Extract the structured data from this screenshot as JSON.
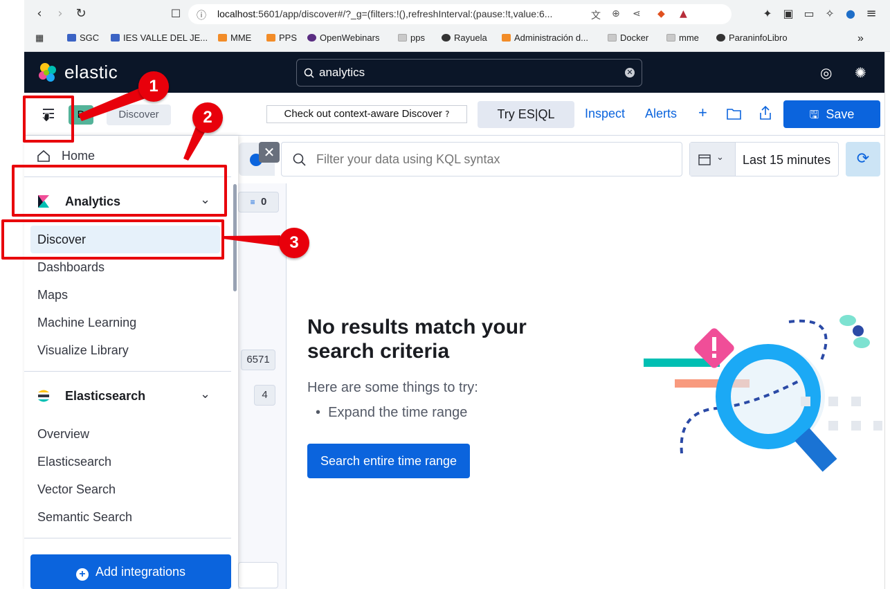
{
  "browser": {
    "url_host": "localhost",
    "url_rest": ":5601/app/discover#/?_g=(filters:!(),refreshInterval:(pause:!t,value:6...",
    "bookmarks": [
      {
        "label": "SGC",
        "icon": "ies-icon"
      },
      {
        "label": "IES VALLE DEL JE...",
        "icon": "ies-icon"
      },
      {
        "label": "MME",
        "icon": "moodle-icon"
      },
      {
        "label": "PPS",
        "icon": "moodle-icon"
      },
      {
        "label": "OpenWebinars",
        "icon": "openwebinars-icon"
      },
      {
        "label": "pps",
        "icon": "folder-icon"
      },
      {
        "label": "Rayuela",
        "icon": "globe-icon"
      },
      {
        "label": "Administración d...",
        "icon": "moodle-icon"
      },
      {
        "label": "Docker",
        "icon": "folder-icon"
      },
      {
        "label": "mme",
        "icon": "folder-icon"
      },
      {
        "label": "ParaninfoLibro",
        "icon": "globe-icon"
      }
    ],
    "overflow": "»"
  },
  "kibana": {
    "logo_text": "elastic",
    "search_value": "analytics",
    "breadcrumb_d": "D",
    "breadcrumb_discover": "Discover",
    "context_aware": "Check out context-aware Discover",
    "try_esql": "Try ES|QL",
    "inspect": "Inspect",
    "alerts": "Alerts",
    "save": "Save",
    "kql_placeholder": "Filter your data using KQL syntax",
    "time_range": "Last 15 minutes",
    "counts": [
      "0",
      "6571",
      "4"
    ]
  },
  "empty_state": {
    "title": "No results match your search criteria",
    "subtitle": "Here are some things to try:",
    "suggestion": "Expand the time range",
    "button": "Search entire time range"
  },
  "sidenav": {
    "home": "Home",
    "analytics": {
      "label": "Analytics",
      "items": [
        "Discover",
        "Dashboards",
        "Maps",
        "Machine Learning",
        "Visualize Library"
      ]
    },
    "elasticsearch": {
      "label": "Elasticsearch",
      "items": [
        "Overview",
        "Elasticsearch",
        "Vector Search",
        "Semantic Search"
      ]
    },
    "add_integrations": "Add integrations"
  },
  "annotations": [
    "1",
    "2",
    "3"
  ],
  "colors": {
    "kibana_header": "#0b1628",
    "primary": "#0b64dd",
    "annotation_red": "#e8000b",
    "active_bg": "#e6f1fa"
  }
}
